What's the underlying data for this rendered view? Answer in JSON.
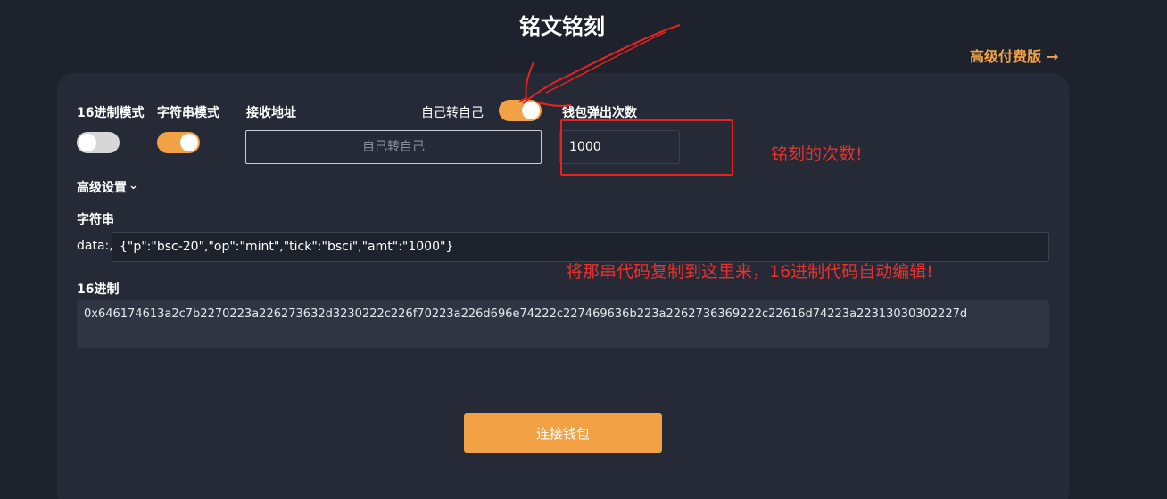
{
  "page": {
    "title": "铭文铭刻",
    "premium_link": "高级付费版",
    "premium_arrow": "→"
  },
  "form": {
    "hex_mode_label": "16进制模式",
    "hex_mode_on": false,
    "string_mode_label": "字符串模式",
    "string_mode_on": true,
    "receive_address_label": "接收地址",
    "receive_address_placeholder": "自己转自己",
    "self_transfer_label": "自己转自己",
    "self_transfer_on": true,
    "wallet_popup_count_label": "钱包弹出次数",
    "wallet_popup_count_value": "1000",
    "advanced_settings_label": "高级设置",
    "advanced_chevron": "⌄",
    "string_section_label": "字符串",
    "data_prefix": "data:,",
    "string_value": "{\"p\":\"bsc-20\",\"op\":\"mint\",\"tick\":\"bsci\",\"amt\":\"1000\"}",
    "hex_section_label": "16进制",
    "hex_value": "0x646174613a2c7b2270223a226273632d3230222c226f70223a226d696e74222c227469636b223a2262736369222c22616d74223a22313030302227d",
    "connect_wallet_button": "连接钱包"
  },
  "annotations": {
    "count_note": "铭刻的次数!",
    "copy_note": "将那串代码复制到这里来，16进制代码自动编辑!"
  },
  "colors": {
    "accent": "#f2a244",
    "background": "#1e222d",
    "panel": "#252a36",
    "annotation_red": "#e8322e"
  }
}
